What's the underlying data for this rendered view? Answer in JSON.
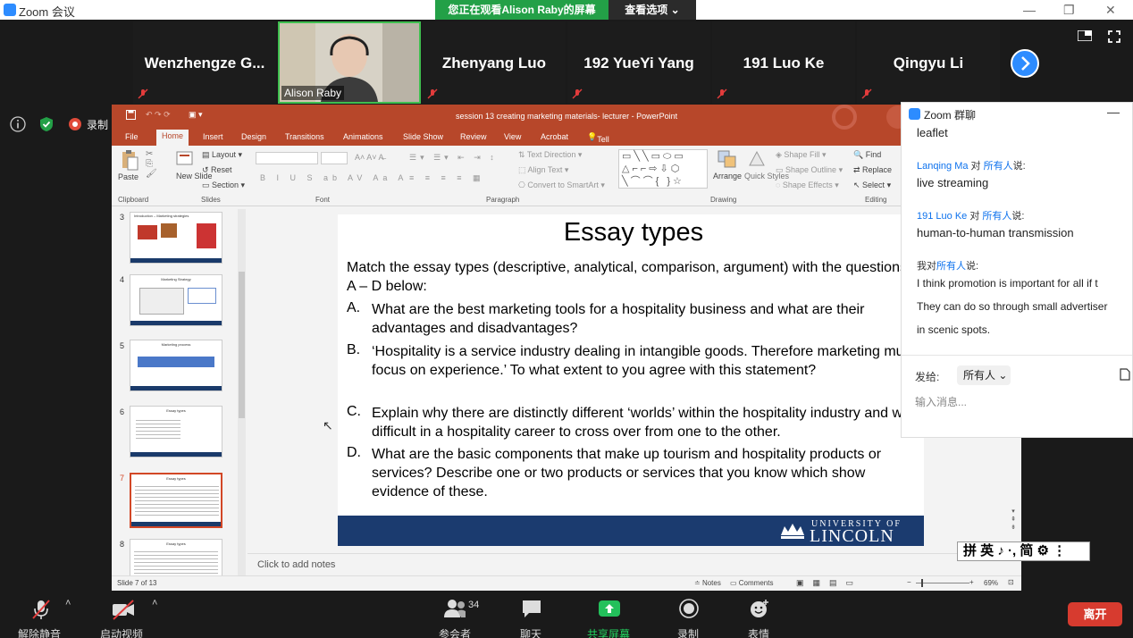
{
  "window": {
    "title": "Zoom 会议",
    "minimize": "—",
    "maximize": "❐",
    "close": "✕"
  },
  "share_banner": {
    "text": "您正在观看Alison Raby的屏幕",
    "view_options": "查看选项 ⌄"
  },
  "participants": [
    {
      "name": "Wenzhengze G..."
    },
    {
      "name": "Alison Raby"
    },
    {
      "name": "Zhenyang Luo"
    },
    {
      "name": "192 YueYi Yang"
    },
    {
      "name": "191 Luo Ke"
    },
    {
      "name": "Qingyu Li"
    }
  ],
  "left_tools": {
    "record_label": "录制"
  },
  "ppt": {
    "window_title": "session 13 creating marketing materials- lecturer - PowerPoint",
    "tabs": [
      "File",
      "Home",
      "Insert",
      "Design",
      "Transitions",
      "Animations",
      "Slide Show",
      "Review",
      "View",
      "Acrobat"
    ],
    "tell_me": "Tell me what you want to do...",
    "ribbon": {
      "paste": "Paste",
      "new_slide": "New Slide",
      "layout": "Layout",
      "reset": "Reset",
      "section": "Section",
      "text_direction": "Text Direction",
      "align_text": "Align Text",
      "convert_smartart": "Convert to SmartArt",
      "arrange": "Arrange",
      "quick_styles": "Quick Styles",
      "shape_fill": "Shape Fill",
      "shape_outline": "Shape Outline",
      "shape_effects": "Shape Effects",
      "find": "Find",
      "replace": "Replace",
      "select": "Select",
      "groups": {
        "clipboard": "Clipboard",
        "slides": "Slides",
        "font": "Font",
        "paragraph": "Paragraph",
        "drawing": "Drawing",
        "editing": "Editing"
      }
    },
    "thumbnails": [
      {
        "num": "3",
        "title": "Introduction – Marketing strategies"
      },
      {
        "num": "4",
        "title": "Marketing Strategy"
      },
      {
        "num": "5",
        "title": "Marketing process"
      },
      {
        "num": "6",
        "title": "Essay types"
      },
      {
        "num": "7",
        "title": "Essay types"
      },
      {
        "num": "8",
        "title": "Essay types"
      }
    ],
    "slide": {
      "title": "Essay types",
      "intro": "Match the essay types (descriptive, analytical, comparison, argument) with the questions A – D below:",
      "items": [
        {
          "letter": "A.",
          "text": "What are the best marketing tools for a hospitality business and what are their advantages and disadvantages?"
        },
        {
          "letter": "B.",
          "text": "‘Hospitality is a service industry dealing in intangible goods.  Therefore marketing must focus on experience.’ To what extent to you agree with this statement?"
        },
        {
          "letter": "C.",
          "text": "Explain why there are distinctly different ‘worlds’ within the hospitality industry and why it is difficult in a hospitality career to cross over from one to the other."
        },
        {
          "letter": "D.",
          "text": "What are the basic components that make up tourism and hospitality products or services? Describe one or two products or services that you know which show evidence of these."
        }
      ],
      "footer_top": "UNIVERSITY OF",
      "footer_bottom": "LINCOLN"
    },
    "notes_placeholder": "Click to add notes",
    "status": {
      "slide": "Slide 7 of 13",
      "notes": "Notes",
      "comments": "Comments",
      "zoom": "69%"
    }
  },
  "chat": {
    "title": "Zoom 群聊",
    "messages": [
      {
        "sender": "",
        "to": "",
        "suffix": "",
        "text": "leaflet"
      },
      {
        "sender": "Lanqing Ma",
        "to": "所有人",
        "suffix": "说:",
        "text": "live streaming"
      },
      {
        "sender": "191 Luo Ke",
        "to": "所有人",
        "suffix": "说:",
        "text": "human-to-human transmission"
      },
      {
        "sender": "我",
        "to": "所有人",
        "suffix": "说:",
        "text": "I think promotion is important for all if t"
      }
    ],
    "my_msg_line2": "They can do so through small advertiser",
    "my_msg_line3": "in scenic spots.",
    "to_label": "发给:",
    "to_value": "所有人",
    "input_placeholder": "输入消息..."
  },
  "toolbar": {
    "mute": "解除静音",
    "video": "启动视频",
    "participants": "参会者",
    "participants_count": "34",
    "chat": "聊天",
    "share": "共享屏幕",
    "record": "录制",
    "reactions": "表情",
    "leave": "离开"
  },
  "ime": {
    "text": "拼 英 ♪ ·, 简 ⚙ ⋮"
  },
  "colors": {
    "zoom_blue": "#2d8cff",
    "share_green": "#23a047",
    "ppt_red": "#b7472a",
    "leave_red": "#d73b2f"
  }
}
